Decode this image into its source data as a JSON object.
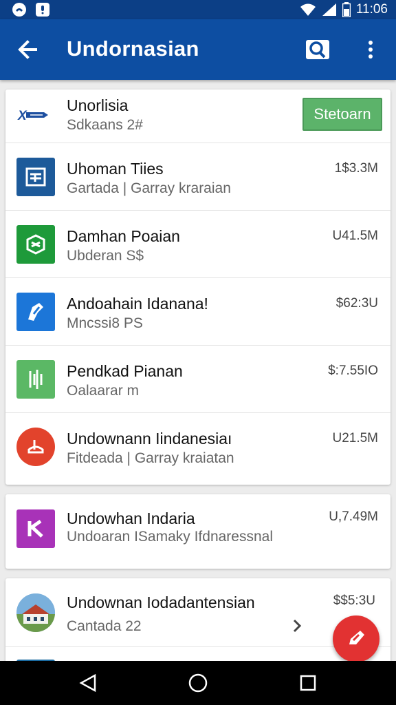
{
  "status_bar": {
    "time": "11:06",
    "icons": [
      "notification-icon",
      "alert-icon",
      "wifi-icon",
      "signal-icon",
      "battery-icon"
    ]
  },
  "app_bar": {
    "title": "Undornasian",
    "icons": [
      "back-arrow-icon",
      "search-icon",
      "more-vert-icon"
    ]
  },
  "list": {
    "featured": {
      "name": "Unorlisia",
      "sub": "Sdkaans 2#",
      "button": "Stetoarn",
      "icon": "logo-icon"
    },
    "items": [
      {
        "name": "Uhoman Tiies",
        "sub": "Gartada | Garray kraraian",
        "value": "1$3.3M",
        "icon": "document-icon",
        "color": "#1d5a9a"
      },
      {
        "name": "Damhan Poaian",
        "sub": "Ubderan S$",
        "value": "U41.5M",
        "icon": "shield-icon",
        "color": "#1e9a3a"
      },
      {
        "name": "Andoahain Idanana!",
        "sub": "Mncssi8 PS",
        "value": "$62:3U",
        "icon": "tag-icon",
        "color": "#1c76d8"
      },
      {
        "name": "Pendkad Pianan",
        "sub": "Oalaarar m",
        "value": "$:7.55IO",
        "icon": "chart-icon",
        "color": "#5bb865"
      },
      {
        "name": "Undownann Iindanesiaı",
        "sub": "Fitdeada | Garray kraiatan",
        "value": "U21.5M",
        "icon": "lamp-icon",
        "color": "#e2432c"
      }
    ],
    "card2": {
      "name": "Undowhan Indaria",
      "sub": "Undoaran ISamaky Ifdnaressnal",
      "value": "U,7.49M",
      "icon": "k-letter-icon",
      "color": "#a832b8"
    },
    "card3": {
      "name": "Undownan Iodadantensian",
      "sub": "Cantada 22",
      "value": "$$5:3U",
      "icon": "building-photo-icon"
    }
  },
  "fab": {
    "icon": "edit-icon",
    "color": "#e23232"
  },
  "nav_bar": {
    "icons": [
      "back-triangle-icon",
      "home-circle-icon",
      "recents-square-icon"
    ]
  }
}
